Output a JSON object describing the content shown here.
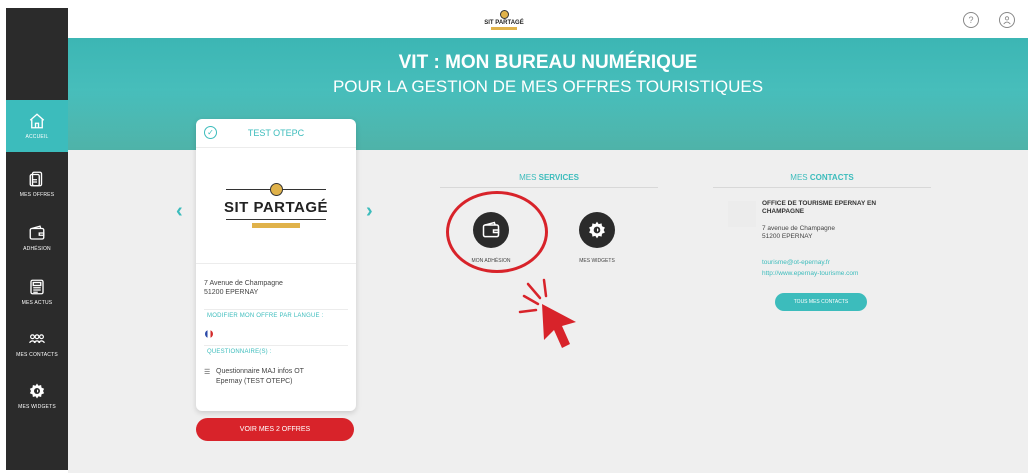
{
  "header": {
    "logo_text": "SIT PARTAGÉ",
    "help_icon": "help-circle-icon",
    "user_icon": "user-circle-icon"
  },
  "hero": {
    "title": "VIT : MON BUREAU NUMÉRIQUE",
    "subtitle": "POUR LA GESTION DE MES OFFRES TOURISTIQUES"
  },
  "sidebar": {
    "items": [
      {
        "label": "ACCUEIL",
        "icon": "home-icon",
        "active": true
      },
      {
        "label": "MES OFFRES",
        "icon": "documents-icon",
        "active": false
      },
      {
        "label": "ADHÉSION",
        "icon": "wallet-icon",
        "active": false
      },
      {
        "label": "MES ACTUS",
        "icon": "newspaper-icon",
        "active": false
      },
      {
        "label": "MES CONTACTS",
        "icon": "people-icon",
        "active": false
      },
      {
        "label": "MES WIDGETS",
        "icon": "gear-icon",
        "active": false
      }
    ]
  },
  "offer_card": {
    "title": "TEST OTEPC",
    "logo_text": "SIT PARTAGÉ",
    "address_line1": "7 Avenue de Champagne",
    "address_line2": "51200 EPERNAY",
    "language_label": "MODIFIER MON OFFRE PAR LANGUE :",
    "questionnaire_label": "QUESTIONNAIRE(S) :",
    "questionnaire_line1": "Questionnaire MAJ infos OT",
    "questionnaire_line2": "Epernay (TEST OTEPC)",
    "button": "VOIR MES 2 OFFRES"
  },
  "services": {
    "title_prefix": "MES ",
    "title_bold": "SERVICES",
    "items": [
      {
        "label": "MON ADHÉSION",
        "icon": "wallet-icon"
      },
      {
        "label": "MES WIDGETS",
        "icon": "gear-icon"
      }
    ]
  },
  "contacts": {
    "title_prefix": "MES ",
    "title_bold": "CONTACTS",
    "name_line1": "OFFICE DE TOURISME EPERNAY EN",
    "name_line2": "CHAMPAGNE",
    "address_line1": "7 avenue de Champagne",
    "address_line2": "51200 EPERNAY",
    "email": "tourisme@ot-epernay.fr",
    "website": "http://www.epernay-tourisme.com",
    "button": "TOUS MES CONTACTS"
  },
  "colors": {
    "accent": "#3cbcbc",
    "red": "#d8232a",
    "sidebar": "#2b2b2b"
  }
}
